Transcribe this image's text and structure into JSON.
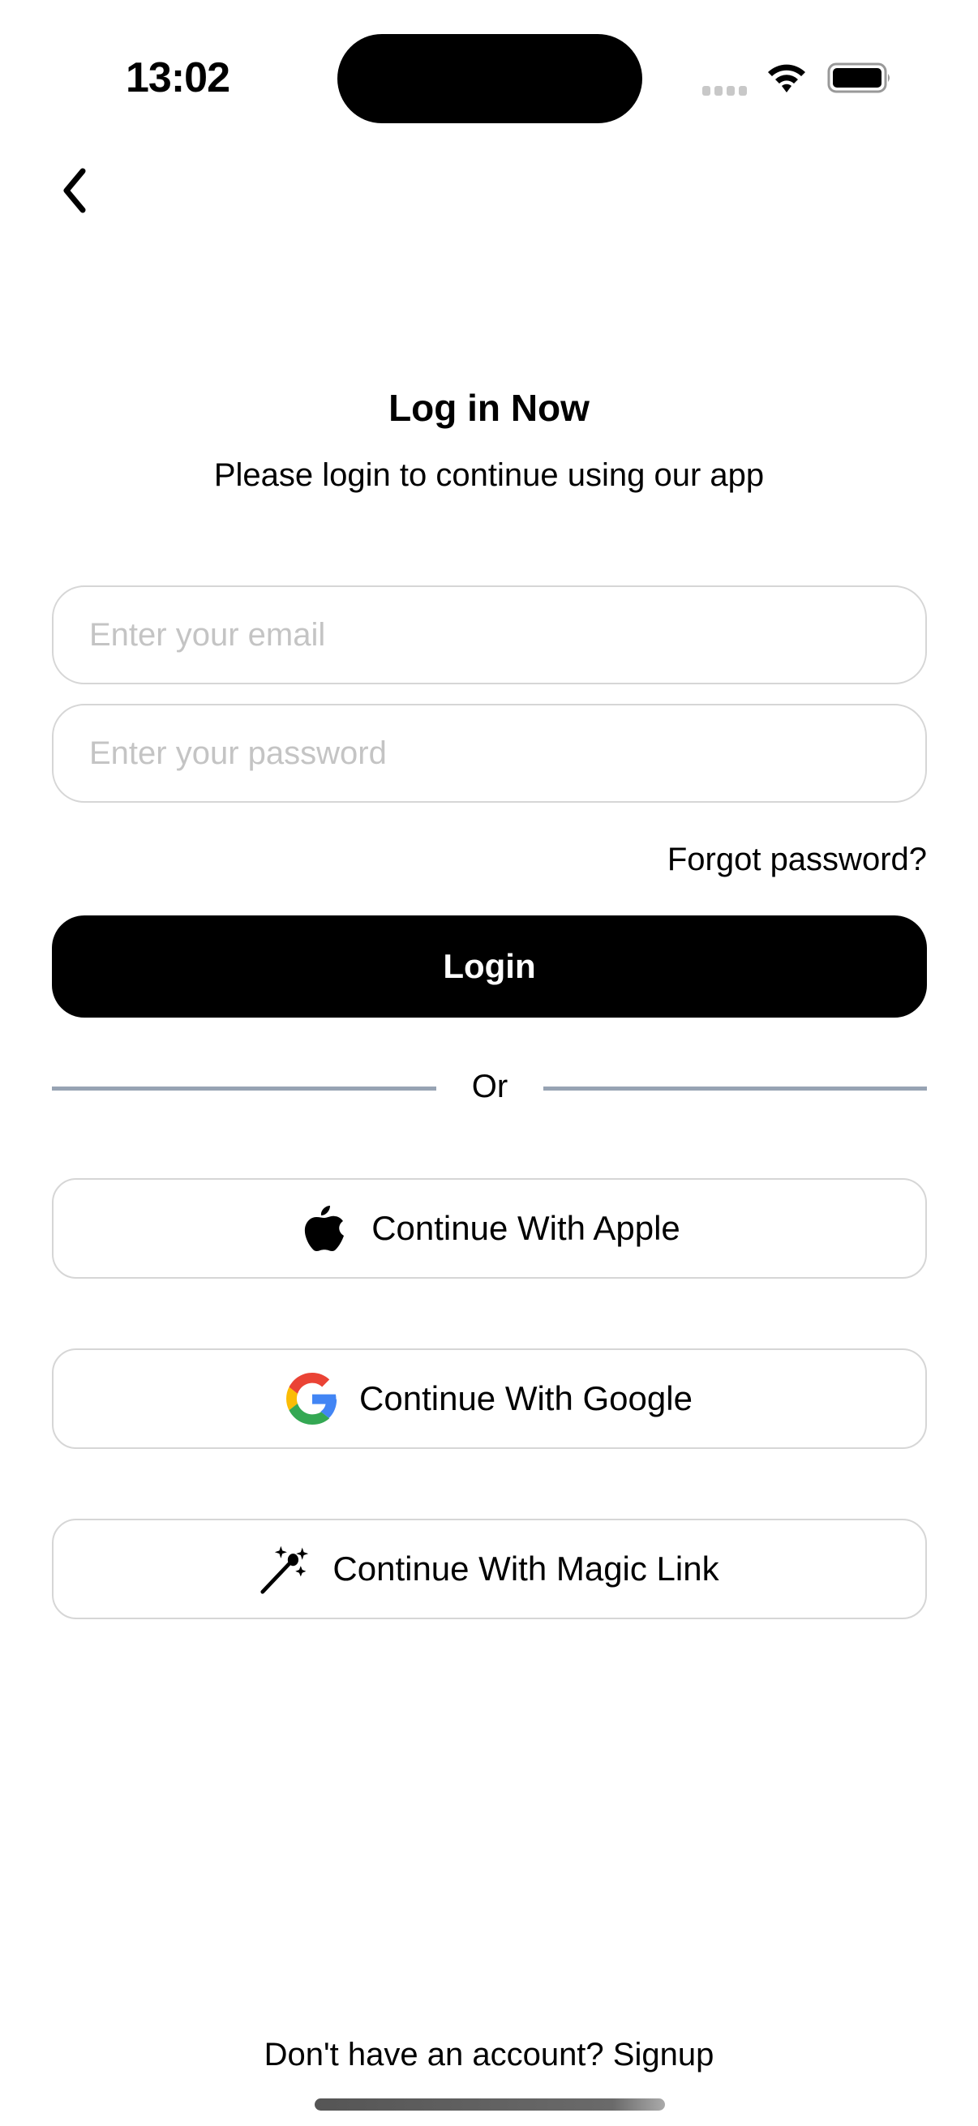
{
  "status_bar": {
    "time": "13:02",
    "icons": [
      "cellular-signal-icon",
      "wifi-icon",
      "battery-icon"
    ]
  },
  "nav": {
    "back_icon": "chevron-left-icon"
  },
  "header": {
    "title": "Log in Now",
    "subtitle": "Please login to continue using our app"
  },
  "form": {
    "email": {
      "value": "",
      "placeholder": "Enter your email"
    },
    "password": {
      "value": "",
      "placeholder": "Enter your password"
    },
    "forgot_label": "Forgot password?",
    "login_label": "Login"
  },
  "divider": {
    "label": "Or"
  },
  "social": [
    {
      "label": "Continue With Apple",
      "icon": "apple-logo-icon"
    },
    {
      "label": "Continue With Google",
      "icon": "google-logo-icon"
    },
    {
      "label": "Continue With Magic Link",
      "icon": "magic-wand-icon"
    }
  ],
  "footer": {
    "prompt": "Don't have an account?",
    "signup_label": "Signup"
  },
  "colors": {
    "primary": "#000000",
    "field_border": "#d6d6d6",
    "placeholder": "#c4c4c4",
    "divider": "#97a3b3",
    "google_red": "#EA4335",
    "google_yellow": "#FBBC05",
    "google_green": "#34A853",
    "google_blue": "#4285F4"
  }
}
